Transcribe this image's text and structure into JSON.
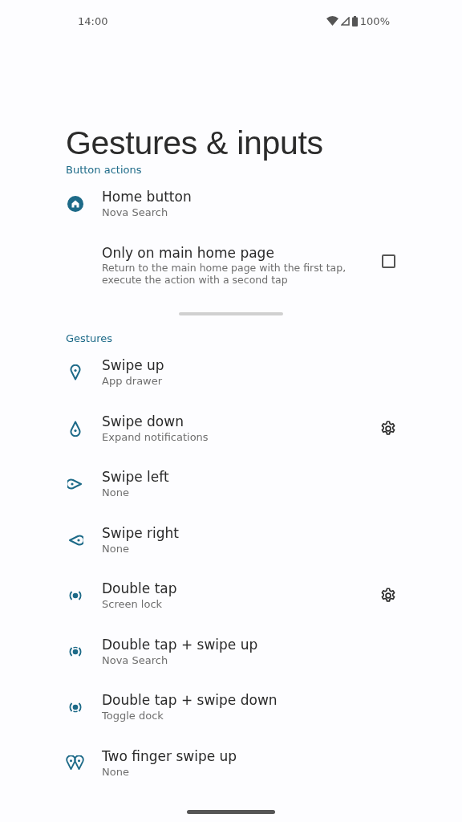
{
  "status_bar": {
    "time": "14:00",
    "battery": "100%"
  },
  "title": "Gestures & inputs",
  "sections": [
    {
      "header": "Button actions",
      "items": [
        {
          "kind": "home",
          "title": "Home button",
          "subtitle": "Nova Search",
          "has_settings": false
        },
        {
          "kind": "checkbox",
          "title": "Only on main home page",
          "subtitle": "Return to the main home page with the first tap, execute the action with a second tap",
          "checked": false
        }
      ]
    },
    {
      "header": "Gestures",
      "items": [
        {
          "kind": "swipe_up",
          "title": "Swipe up",
          "subtitle": "App drawer",
          "has_settings": false
        },
        {
          "kind": "swipe_down",
          "title": "Swipe down",
          "subtitle": "Expand notifications",
          "has_settings": true
        },
        {
          "kind": "swipe_left",
          "title": "Swipe left",
          "subtitle": "None",
          "has_settings": false
        },
        {
          "kind": "swipe_right",
          "title": "Swipe right",
          "subtitle": "None",
          "has_settings": false
        },
        {
          "kind": "double_tap",
          "title": "Double tap",
          "subtitle": "Screen lock",
          "has_settings": true
        },
        {
          "kind": "double_tap_up",
          "title": "Double tap + swipe up",
          "subtitle": "Nova Search",
          "has_settings": false
        },
        {
          "kind": "double_tap_down",
          "title": "Double tap + swipe down",
          "subtitle": "Toggle dock",
          "has_settings": false
        },
        {
          "kind": "two_finger_up",
          "title": "Two finger swipe up",
          "subtitle": "None",
          "has_settings": false
        }
      ]
    }
  ]
}
